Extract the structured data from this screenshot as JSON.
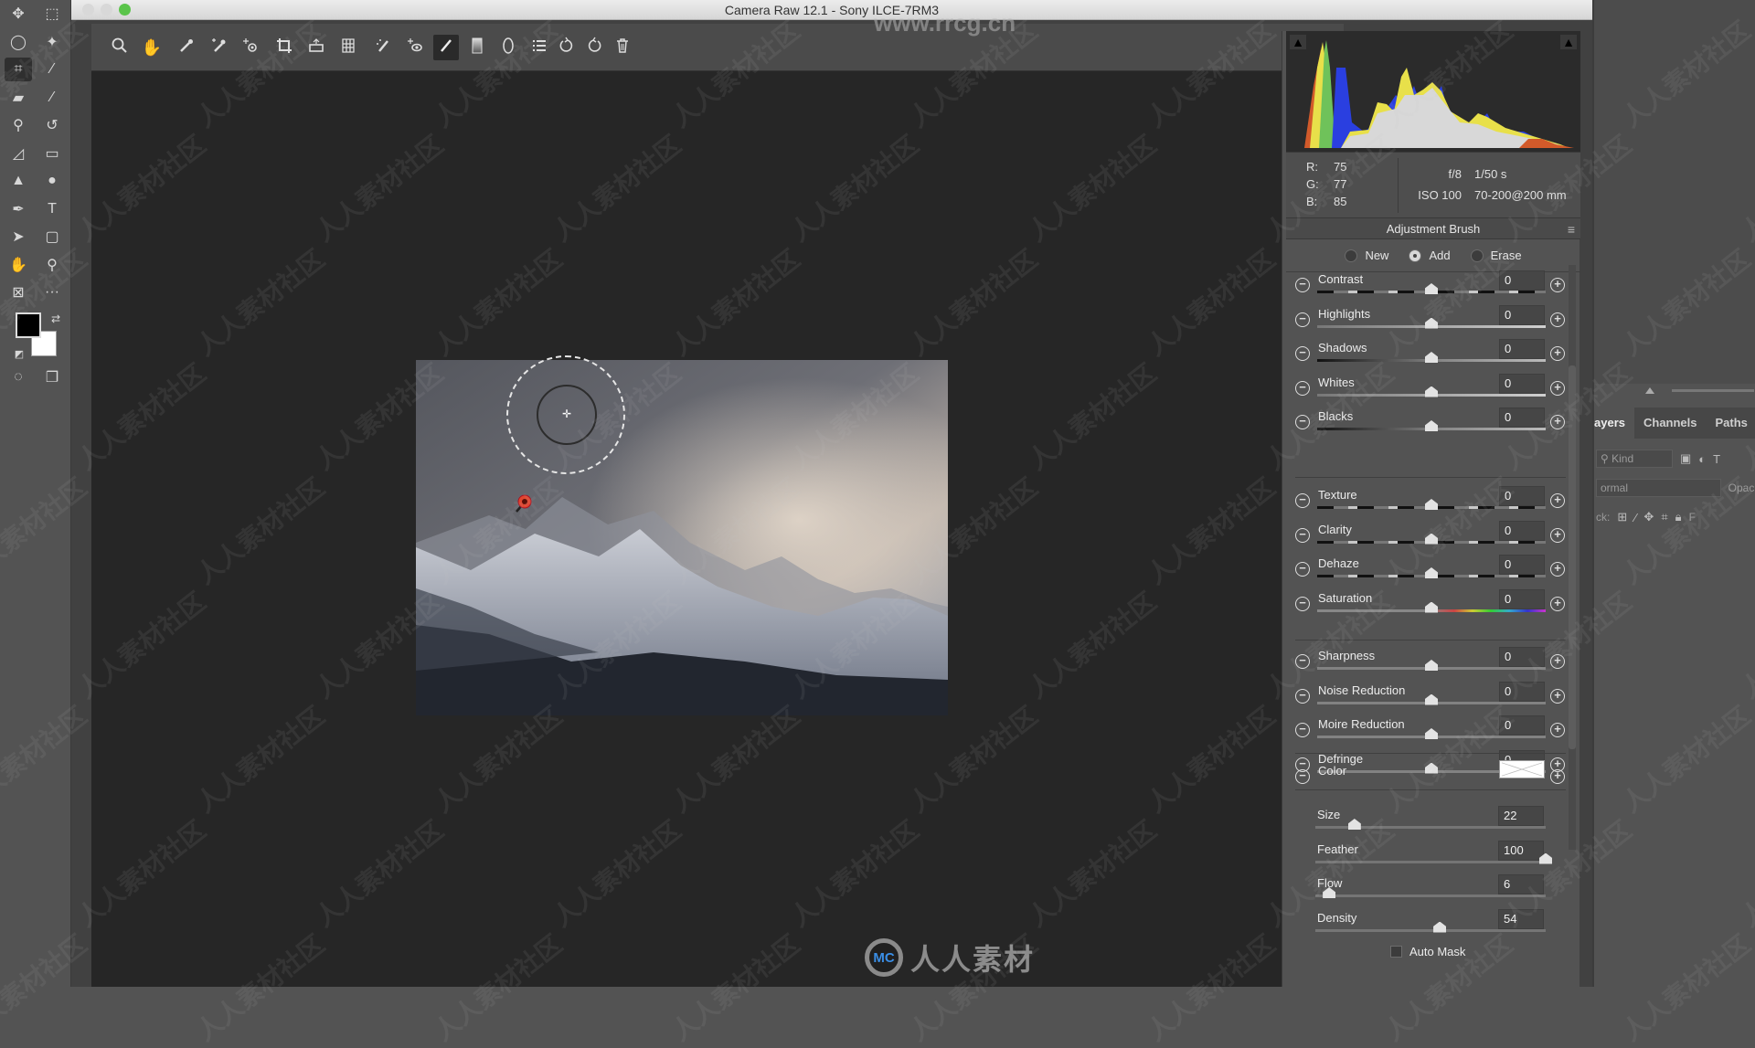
{
  "window": {
    "title": "Camera Raw 12.1  -  Sony ILCE-7RM3",
    "watermark_url": "www.rrcg.cn"
  },
  "ps_toolbar": {
    "tools": [
      {
        "name": "move-tool",
        "glyph": "✥"
      },
      {
        "name": "marquee-tool",
        "glyph": "⬚"
      },
      {
        "name": "lasso-tool",
        "glyph": "◯"
      },
      {
        "name": "magic-wand-tool",
        "glyph": "✦"
      },
      {
        "name": "crop-tool",
        "glyph": "⌗",
        "active": true
      },
      {
        "name": "eyedropper-tool",
        "glyph": "⁄"
      },
      {
        "name": "healing-brush-tool",
        "glyph": "▰"
      },
      {
        "name": "brush-tool",
        "glyph": "⁄"
      },
      {
        "name": "clone-stamp-tool",
        "glyph": "⚲"
      },
      {
        "name": "history-brush-tool",
        "glyph": "↺"
      },
      {
        "name": "eraser-tool",
        "glyph": "◿"
      },
      {
        "name": "gradient-tool",
        "glyph": "▭"
      },
      {
        "name": "blur-tool",
        "glyph": "▲"
      },
      {
        "name": "dodge-tool",
        "glyph": "●"
      },
      {
        "name": "pen-tool",
        "glyph": "✒"
      },
      {
        "name": "type-tool",
        "glyph": "T"
      },
      {
        "name": "path-selection-tool",
        "glyph": "➤"
      },
      {
        "name": "shape-tool",
        "glyph": "▢"
      },
      {
        "name": "hand-tool",
        "glyph": "✋"
      },
      {
        "name": "zoom-tool",
        "glyph": "⚲"
      },
      {
        "name": "frame-tool",
        "glyph": "⊠"
      },
      {
        "name": "more-tools",
        "glyph": "···"
      },
      {
        "name": "quick-mask",
        "glyph": "◌"
      },
      {
        "name": "screen-mode",
        "glyph": "❐"
      }
    ]
  },
  "ps_panels": {
    "tabs": [
      "Layers",
      "Channels",
      "Paths"
    ],
    "tab_layers_visible": "ayers",
    "kind_filter": "Kind",
    "blend_mode": "ormal",
    "opacity_label": "Opaci",
    "lock_label": "ck:",
    "fill_label": "F"
  },
  "cr_toolbar": {
    "tools": [
      "zoom-tool",
      "hand-tool",
      "white-balance-tool",
      "color-sampler-tool",
      "targeted-adjustment-tool",
      "crop-tool",
      "straighten-tool",
      "transform-tool",
      "spot-removal-tool",
      "red-eye-tool",
      "adjustment-brush-tool",
      "graduated-filter-tool",
      "radial-filter-tool",
      "preferences",
      "rotate-left",
      "rotate-right",
      "delete"
    ],
    "active_tool": "adjustment-brush-tool"
  },
  "info": {
    "r_label": "R:",
    "r": "75",
    "g_label": "G:",
    "g": "77",
    "b_label": "B:",
    "b": "85",
    "aperture": "f/8",
    "shutter": "1/50 s",
    "iso": "ISO 100",
    "lens": "70-200@200 mm"
  },
  "adjustment_brush": {
    "title": "Adjustment Brush",
    "modes": [
      {
        "label": "New",
        "selected": false
      },
      {
        "label": "Add",
        "selected": true
      },
      {
        "label": "Erase",
        "selected": false
      }
    ],
    "group1": [
      {
        "label": "Contrast",
        "value": "0",
        "norm": 0.5,
        "track": "dash"
      },
      {
        "label": "Highlights",
        "value": "0",
        "norm": 0.5,
        "track": "light"
      },
      {
        "label": "Shadows",
        "value": "0",
        "norm": 0.5,
        "track": "shadow"
      },
      {
        "label": "Whites",
        "value": "0",
        "norm": 0.5,
        "track": "light"
      },
      {
        "label": "Blacks",
        "value": "0",
        "norm": 0.5,
        "track": "shadow"
      }
    ],
    "group2": [
      {
        "label": "Texture",
        "value": "0",
        "norm": 0.5,
        "track": "dash"
      },
      {
        "label": "Clarity",
        "value": "0",
        "norm": 0.5,
        "track": "dash"
      },
      {
        "label": "Dehaze",
        "value": "0",
        "norm": 0.5,
        "track": "dash"
      },
      {
        "label": "Saturation",
        "value": "0",
        "norm": 0.5,
        "track": "sat"
      }
    ],
    "group3": [
      {
        "label": "Sharpness",
        "value": "0",
        "norm": 0.5,
        "track": "plain"
      },
      {
        "label": "Noise Reduction",
        "value": "0",
        "norm": 0.5,
        "track": "plain"
      },
      {
        "label": "Moire Reduction",
        "value": "0",
        "norm": 0.5,
        "track": "plain"
      },
      {
        "label": "Defringe",
        "value": "0",
        "norm": 0.5,
        "track": "plain"
      }
    ],
    "color_label": "Color",
    "color_value": "#ffffff",
    "brush": [
      {
        "label": "Size",
        "value": "22",
        "norm": 0.17
      },
      {
        "label": "Feather",
        "value": "100",
        "norm": 1.0
      },
      {
        "label": "Flow",
        "value": "6",
        "norm": 0.06
      },
      {
        "label": "Density",
        "value": "54",
        "norm": 0.54
      }
    ],
    "auto_mask_label": "Auto Mask",
    "auto_mask_checked": false
  },
  "logo": {
    "mark": "MC",
    "text": "人人素材"
  },
  "watermark_text": "人人素材社区",
  "colors": {
    "pin": "#e0452f",
    "traffic_green": "#5ac44a"
  }
}
